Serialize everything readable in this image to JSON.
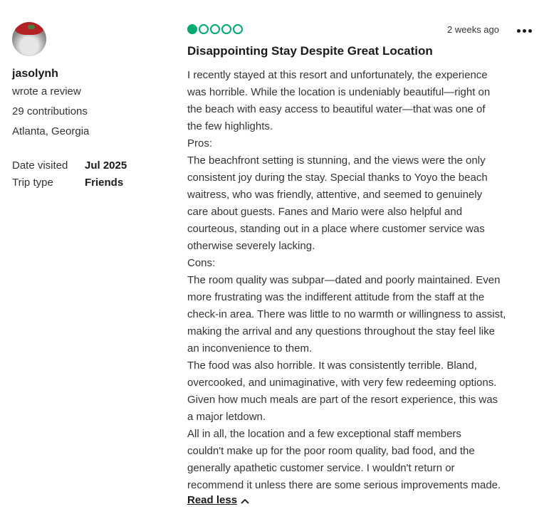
{
  "author": {
    "name": "jasolynh",
    "action": "wrote a review",
    "contributions": "29 contributions",
    "location": "Atlanta, Georgia"
  },
  "details": {
    "date_visited_label": "Date visited",
    "date_visited_value": "Jul 2025",
    "trip_type_label": "Trip type",
    "trip_type_value": "Friends"
  },
  "review": {
    "rating": 1,
    "rating_max": 5,
    "posted": "2 weeks ago",
    "title": "Disappointing Stay Despite Great Location",
    "lines": [
      "I recently stayed at this resort and unfortunately, the experience",
      "was horrible. While the location is undeniably beautiful—right on",
      "the beach with easy access to beautiful water—that was one of",
      "the few highlights.",
      "Pros:",
      "The beachfront setting is stunning, and the views were the only",
      "consistent joy during the stay. Special thanks to Yoyo the beach",
      "waitress, who was friendly, attentive, and seemed to genuinely",
      "care about guests. Fanes and Mario were also helpful and",
      "courteous, standing out in a place where customer service was",
      "otherwise severely lacking.",
      "Cons:",
      "The room quality was subpar—dated and  poorly maintained. Even",
      "more frustrating was the indifferent attitude from the staff at the",
      "check-in area. There was little to no warmth or willingness to assist,",
      "making the arrival and any questions throughout the stay feel like",
      "an inconvenience to them.",
      "The food was also horrible. It was consistently terrible. Bland,",
      "overcooked, and unimaginative, with very few redeeming options.",
      "Given how much meals are part of the resort experience, this was",
      "a major letdown.",
      "All in all, the location and a few exceptional staff members",
      "couldn't make up for the poor room quality, bad food, and the",
      "generally apathetic customer service. I wouldn't return or",
      "recommend it unless there are some serious improvements made."
    ],
    "read_less": "Read less"
  },
  "colors": {
    "rating_green": "#00aa6c",
    "text": "#1a1a1a"
  },
  "icons": {
    "more": "ellipsis-icon",
    "chevron": "chevron-up-icon"
  }
}
